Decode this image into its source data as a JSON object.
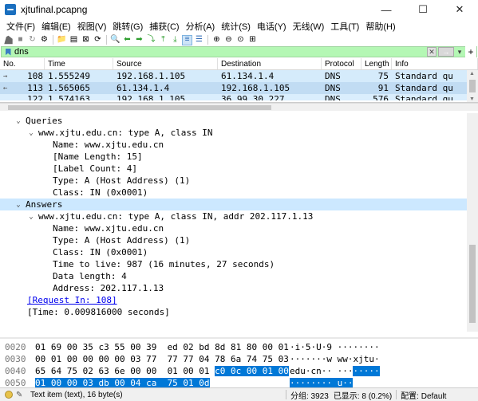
{
  "window": {
    "title": "xjtufinal.pcapng",
    "min": "—",
    "max": "☐",
    "close": "✕"
  },
  "menu": [
    "文件(F)",
    "编辑(E)",
    "视图(V)",
    "跳转(G)",
    "捕获(C)",
    "分析(A)",
    "统计(S)",
    "电话(Y)",
    "无线(W)",
    "工具(T)",
    "帮助(H)"
  ],
  "filter": {
    "value": "dns"
  },
  "packet_list": {
    "columns": [
      "No.",
      "Time",
      "Source",
      "Destination",
      "Protocol",
      "Length",
      "Info"
    ],
    "rows": [
      {
        "no": "108",
        "time": "1.555249",
        "src": "192.168.1.105",
        "dst": "61.134.1.4",
        "proto": "DNS",
        "len": "75",
        "info": "Standard qu"
      },
      {
        "no": "113",
        "time": "1.565065",
        "src": "61.134.1.4",
        "dst": "192.168.1.105",
        "proto": "DNS",
        "len": "91",
        "info": "Standard qu"
      },
      {
        "no": "122",
        "time": "1.574163",
        "src": "192.168.1.105",
        "dst": "36.99.30.227",
        "proto": "DNS",
        "len": "576",
        "info": "Standard qu"
      }
    ]
  },
  "details": {
    "queries": "Queries",
    "query": "www.xjtu.edu.cn: type A, class IN",
    "q_name": "Name: www.xjtu.edu.cn",
    "q_name_len": "[Name Length: 15]",
    "q_label_count": "[Label Count: 4]",
    "q_type": "Type: A (Host Address) (1)",
    "q_class": "Class: IN (0x0001)",
    "answers": "Answers",
    "answer": "www.xjtu.edu.cn: type A, class IN, addr 202.117.1.13",
    "a_name": "Name: www.xjtu.edu.cn",
    "a_type": "Type: A (Host Address) (1)",
    "a_class": "Class: IN (0x0001)",
    "a_ttl": "Time to live: 987 (16 minutes, 27 seconds)",
    "a_len": "Data length: 4",
    "a_addr": "Address: 202.117.1.13",
    "request_in": "[Request In: 108]",
    "time": "[Time: 0.009816000 seconds]"
  },
  "bytes": [
    {
      "off": "0020",
      "hex": "01 69 00 35 c3 55 00 39  ed 02 bd 8d 81 80 00 01",
      "hex_hl": "",
      "hex_tail": "",
      "ascii": "·i·5·U·9 ········",
      "ascii_hl": "",
      "ascii_tail": ""
    },
    {
      "off": "0030",
      "hex": "00 01 00 00 00 00 03 77  77 77 04 78 6a 74 75 03",
      "hex_hl": "",
      "hex_tail": "",
      "ascii": "·······w ww·xjtu·",
      "ascii_hl": "",
      "ascii_tail": ""
    },
    {
      "off": "0040",
      "hex": "65 64 75 02 63 6e 00 00  01 00 01 ",
      "hex_hl": "c0 0c 00 01 00",
      "hex_tail": "",
      "ascii": "edu·cn·· ···",
      "ascii_hl": "·····",
      "ascii_tail": ""
    },
    {
      "off": "0050",
      "hex": "",
      "hex_hl": "01 00 00 03 db 00 04 ca  75 01 0d",
      "hex_tail": "",
      "ascii": "",
      "ascii_hl": "········ u··",
      "ascii_tail": ""
    }
  ],
  "status": {
    "item": "Text item (text), 16 byte(s)",
    "packets": "分组: 3923",
    "displayed": "已显示: 8 (0.2%)",
    "profile": "配置: Default"
  },
  "colors": {
    "filter_bg": "#b4f7b4",
    "selected_row": "#c1dcf3",
    "byte_highlight": "#0078d7"
  }
}
